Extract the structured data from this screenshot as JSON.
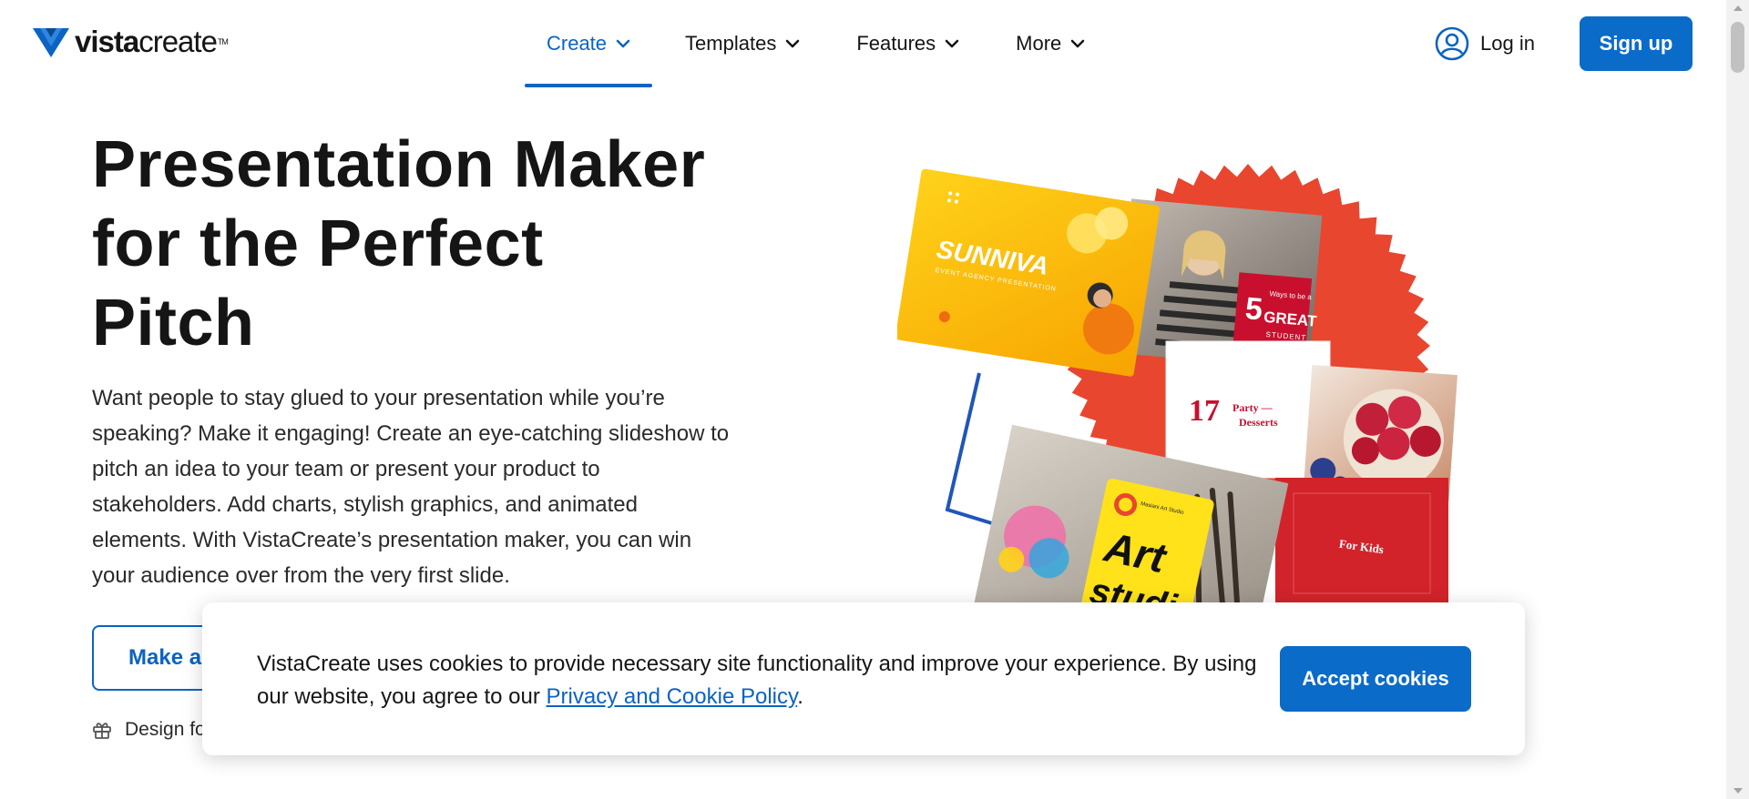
{
  "header": {
    "logo": {
      "brand_bold": "vista",
      "brand_light": "create",
      "trademark": "TM"
    },
    "nav": [
      {
        "label": "Create",
        "active": true
      },
      {
        "label": "Templates",
        "active": false
      },
      {
        "label": "Features",
        "active": false
      },
      {
        "label": "More",
        "active": false
      }
    ],
    "login_label": "Log in",
    "signup_label": "Sign up"
  },
  "hero": {
    "title_lines": [
      "Presentation Maker",
      "for the Perfect",
      "Pitch"
    ],
    "description": "Want people to stay glued to your presentation while you’re speaking? Make it engaging! Create an eye-catching slideshow to pitch an idea to your team or present your product to stakeholders. Add charts, stylish graphics, and animated elements. With VistaCreate’s presentation maker, you can win your audience over from the very first slide.",
    "cta_label": "Make a",
    "note": "Design fo"
  },
  "collage": {
    "card_sunniva_title": "SUNNIVA",
    "card_sunniva_subtitle": "EVENT AGENCY PRESENTATION",
    "card_student_number": "5",
    "card_student_ways": "Ways to be a",
    "card_student_great": "GREAT",
    "card_student_word": "STUDENT",
    "card_party_number": "17",
    "card_party_text_1": "Party —",
    "card_party_text_2": "Desserts",
    "card_art_school": "Masiani Art Studio",
    "card_art_title_1": "Art",
    "card_art_title_2": "studio",
    "card_kids": "For Kids"
  },
  "cookie_banner": {
    "text_before_link": "VistaCreate uses cookies to provide necessary site functionality and improve your experience. By using our website, you agree to our ",
    "link_label": "Privacy and Cookie Policy",
    "text_after_link": ".",
    "accept_label": "Accept cookies"
  },
  "colors": {
    "brand_blue": "#0b6bc9",
    "link_blue": "#0b63c2",
    "accent_red": "#e8462f",
    "text_dark": "#151515"
  }
}
